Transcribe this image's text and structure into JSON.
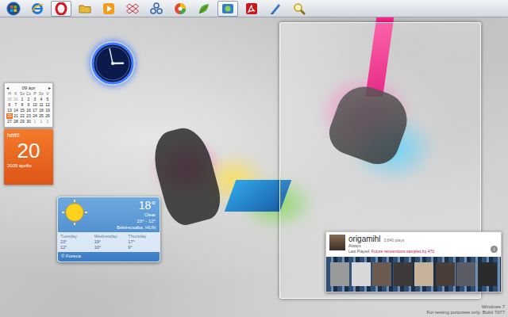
{
  "taskbar": {
    "buttons": [
      {
        "kind": "start",
        "active": false
      },
      {
        "kind": "ie",
        "active": false
      },
      {
        "kind": "opera",
        "active": true
      },
      {
        "kind": "folder",
        "active": false
      },
      {
        "kind": "media",
        "active": false
      },
      {
        "kind": "dropbox",
        "active": false
      },
      {
        "kind": "network",
        "active": false
      },
      {
        "kind": "picasa",
        "active": false
      },
      {
        "kind": "leaf",
        "active": false
      },
      {
        "kind": "app",
        "active": true
      },
      {
        "kind": "acrobat",
        "active": false
      },
      {
        "kind": "pen",
        "active": false
      },
      {
        "kind": "search",
        "active": false
      }
    ]
  },
  "clock": {
    "hour": 2,
    "minute": 58
  },
  "calendar": {
    "prev": "◂",
    "month": "09 ápr",
    "next": "▸",
    "weekdays": [
      "H",
      "K",
      "Sz",
      "Cs",
      "P",
      "Sz",
      "V"
    ],
    "days": [
      {
        "d": "30",
        "muted": true,
        "selected": false
      },
      {
        "d": "31",
        "muted": true,
        "selected": false
      },
      {
        "d": "1",
        "muted": false,
        "selected": false
      },
      {
        "d": "2",
        "muted": false,
        "selected": false
      },
      {
        "d": "3",
        "muted": false,
        "selected": false
      },
      {
        "d": "4",
        "muted": false,
        "selected": false
      },
      {
        "d": "5",
        "muted": false,
        "selected": false
      },
      {
        "d": "6",
        "muted": false,
        "selected": false
      },
      {
        "d": "7",
        "muted": false,
        "selected": false
      },
      {
        "d": "8",
        "muted": false,
        "selected": false
      },
      {
        "d": "9",
        "muted": false,
        "selected": false
      },
      {
        "d": "10",
        "muted": false,
        "selected": false
      },
      {
        "d": "11",
        "muted": false,
        "selected": false
      },
      {
        "d": "12",
        "muted": false,
        "selected": false
      },
      {
        "d": "13",
        "muted": false,
        "selected": false
      },
      {
        "d": "14",
        "muted": false,
        "selected": false
      },
      {
        "d": "15",
        "muted": false,
        "selected": false
      },
      {
        "d": "16",
        "muted": false,
        "selected": false
      },
      {
        "d": "17",
        "muted": false,
        "selected": false
      },
      {
        "d": "18",
        "muted": false,
        "selected": false
      },
      {
        "d": "19",
        "muted": false,
        "selected": false
      },
      {
        "d": "20",
        "muted": false,
        "selected": true
      },
      {
        "d": "21",
        "muted": false,
        "selected": false
      },
      {
        "d": "22",
        "muted": false,
        "selected": false
      },
      {
        "d": "23",
        "muted": false,
        "selected": false
      },
      {
        "d": "24",
        "muted": false,
        "selected": false
      },
      {
        "d": "25",
        "muted": false,
        "selected": false
      },
      {
        "d": "26",
        "muted": false,
        "selected": false
      },
      {
        "d": "27",
        "muted": false,
        "selected": false
      },
      {
        "d": "28",
        "muted": false,
        "selected": false
      },
      {
        "d": "29",
        "muted": false,
        "selected": false
      },
      {
        "d": "30",
        "muted": false,
        "selected": false
      },
      {
        "d": "1",
        "muted": true,
        "selected": false
      },
      {
        "d": "2",
        "muted": true,
        "selected": false
      },
      {
        "d": "3",
        "muted": true,
        "selected": false
      }
    ],
    "weekday": "hétfő",
    "day": "20",
    "month_year": "2009 április"
  },
  "weather": {
    "temp": "18°",
    "condition": "Clear",
    "range": "23° - 12°",
    "location": "Békéscsaba, HUN",
    "forecast": [
      {
        "day": "Tuesday",
        "high": "23°",
        "low": "12°"
      },
      {
        "day": "Wednesday",
        "high": "19°",
        "low": "10°"
      },
      {
        "day": "Thursday",
        "high": "17°",
        "low": "9°"
      }
    ],
    "credit": "© Foreca"
  },
  "lastfm": {
    "user": "origamihl",
    "plays": "3,840 plays",
    "status": "Always",
    "last_played_label": "Last Played:",
    "last_played": "Future reinventions samples by 470",
    "info": "i",
    "thumbnails": [
      {
        "color": "#9a9a9a"
      },
      {
        "color": "#d8d8d8"
      },
      {
        "color": "#6b5a4e"
      },
      {
        "color": "#3e3a3a"
      },
      {
        "color": "#c7b39a"
      },
      {
        "color": "#4a3e38"
      },
      {
        "color": "#5c5c66"
      },
      {
        "color": "#2b2b2b"
      }
    ]
  },
  "watermark": {
    "line1": "Windows 7",
    "line2": "For testing purposes only. Build 7077"
  }
}
